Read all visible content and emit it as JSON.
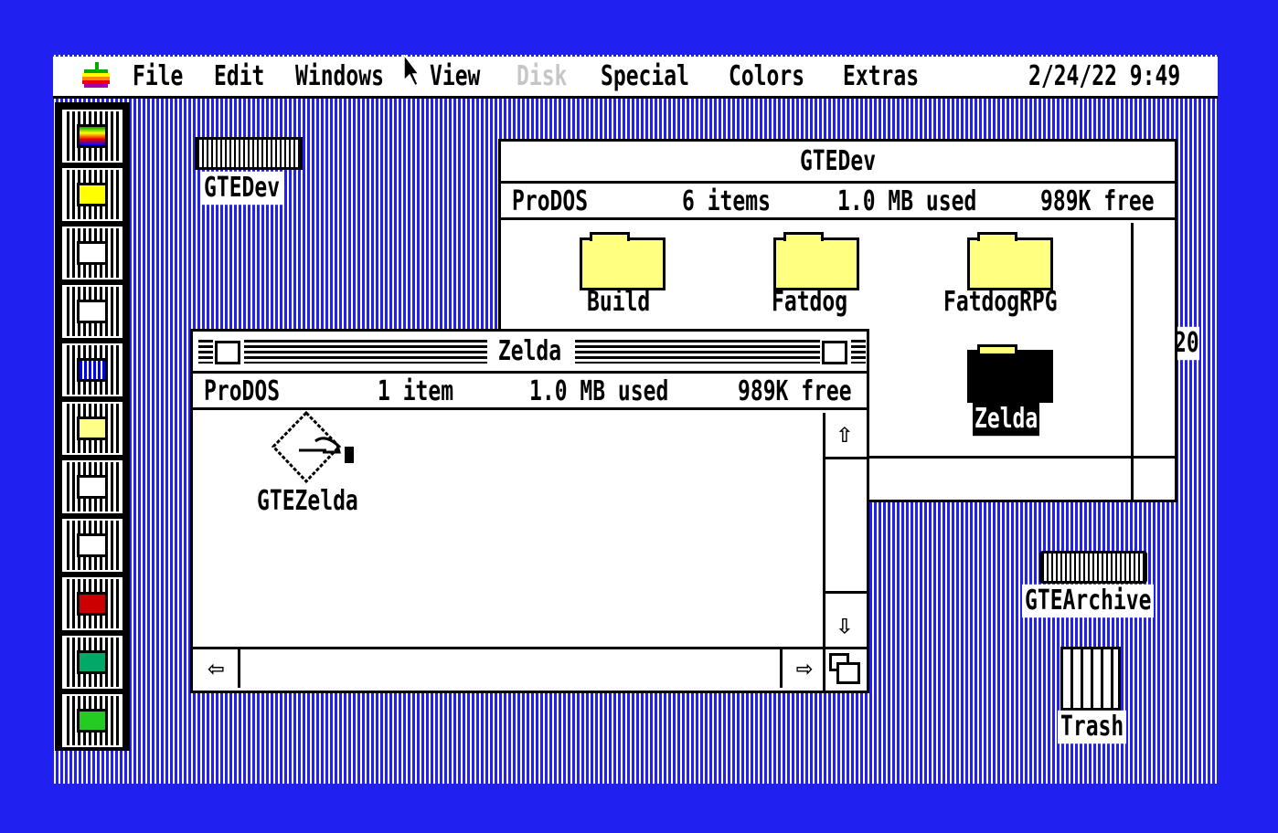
{
  "menubar": {
    "items": [
      {
        "label": "File",
        "enabled": true
      },
      {
        "label": "Edit",
        "enabled": true
      },
      {
        "label": "Windows",
        "enabled": true
      },
      {
        "label": "View",
        "enabled": true
      },
      {
        "label": "Disk",
        "enabled": false
      },
      {
        "label": "Special",
        "enabled": true
      },
      {
        "label": "Colors",
        "enabled": true
      },
      {
        "label": "Extras",
        "enabled": true
      }
    ],
    "clock": "2/24/22 9:49",
    "apple_icon": "rainbow-apple-icon"
  },
  "dock": {
    "items": [
      "apple-icon",
      "folder-icon",
      "control-panel-icon",
      "windows-icon",
      "display-icon",
      "checklist-icon",
      "keyboard-icon",
      "printer-icon",
      "red-disk-icon",
      "green-disk-icon",
      "return-arrow-icon"
    ]
  },
  "desktop": {
    "icons": [
      {
        "label": "GTEDev",
        "icon": "hard-drive-icon"
      },
      {
        "label": "GTEArchive",
        "icon": "hard-drive-icon"
      },
      {
        "label": "Trash",
        "icon": "trash-icon"
      },
      {
        "label": "20",
        "icon": "partial-label"
      }
    ]
  },
  "gtedev_window": {
    "title": "GTEDev",
    "info": {
      "volume": "ProDOS",
      "items": "6 items",
      "used": "1.0 MB used",
      "free": "989K free"
    },
    "icons": [
      {
        "label": "Build"
      },
      {
        "label": "Fatdog"
      },
      {
        "label": "FatdogRPG"
      },
      {
        "label": "Zelda",
        "selected": true
      }
    ]
  },
  "zelda_window": {
    "title": "Zelda",
    "info": {
      "volume": "ProDOS",
      "items": "1 item",
      "used": "1.0 MB used",
      "free": "989K free"
    },
    "icons": [
      {
        "label": "GTEZelda",
        "icon": "application-icon"
      }
    ]
  },
  "colors": {
    "desktop": "#2020f0",
    "folder": "#ffff80"
  }
}
